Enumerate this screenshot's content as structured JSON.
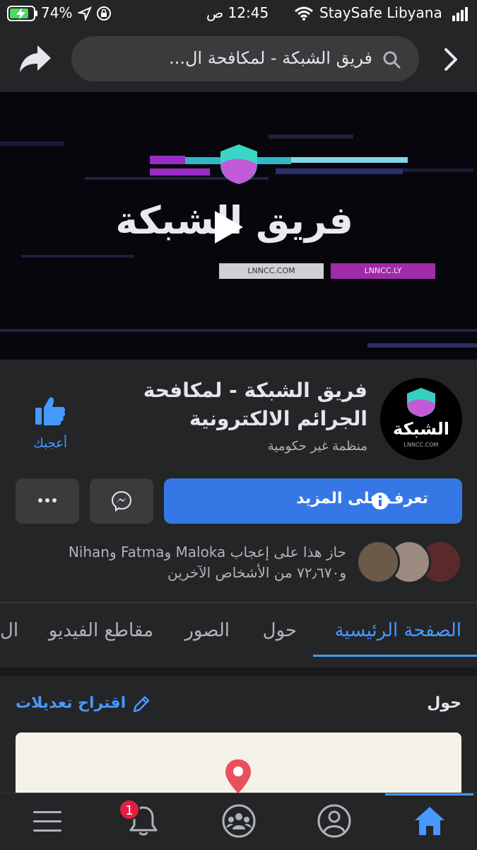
{
  "status_bar": {
    "battery": "74%",
    "time": "12:45 ص",
    "carrier": "StaySafe Libyana"
  },
  "nav": {
    "search_text": "فريق الشبكة - لمكافحة ال..."
  },
  "video": {
    "title_art": "فريق الشبكة",
    "link_left": "LNNCC.COM",
    "link_right": "LNNCC.LY"
  },
  "page": {
    "name": "فريق الشبكة - لمكافحة الجرائم الالكترونية",
    "category": "منظمة غير حكومية",
    "avatar_text": "الشبكة",
    "avatar_subtext": "LNNCC.COM",
    "like_label": "أعجبك",
    "learn_more_label": "تعرف على المزيد",
    "likes_summary": "حاز هذا على إعجاب Maloka وFatma وNihan و٧٢٫٦٧٠ من الأشخاص الآخرين"
  },
  "tabs": [
    {
      "label": "الصفحة الرئيسية",
      "active": true
    },
    {
      "label": "حول",
      "active": false
    },
    {
      "label": "الصور",
      "active": false
    },
    {
      "label": "مقاطع الفيديو",
      "active": false
    },
    {
      "label": "ال",
      "active": false
    }
  ],
  "about": {
    "heading": "حول",
    "suggest_edits": "اقتراح تعديلات"
  },
  "bottom_bar": {
    "notifications_badge": "1"
  },
  "colors": {
    "accent": "#4599ff",
    "button_primary": "#3578e5",
    "background": "#242526",
    "badge": "#e41e3f"
  }
}
